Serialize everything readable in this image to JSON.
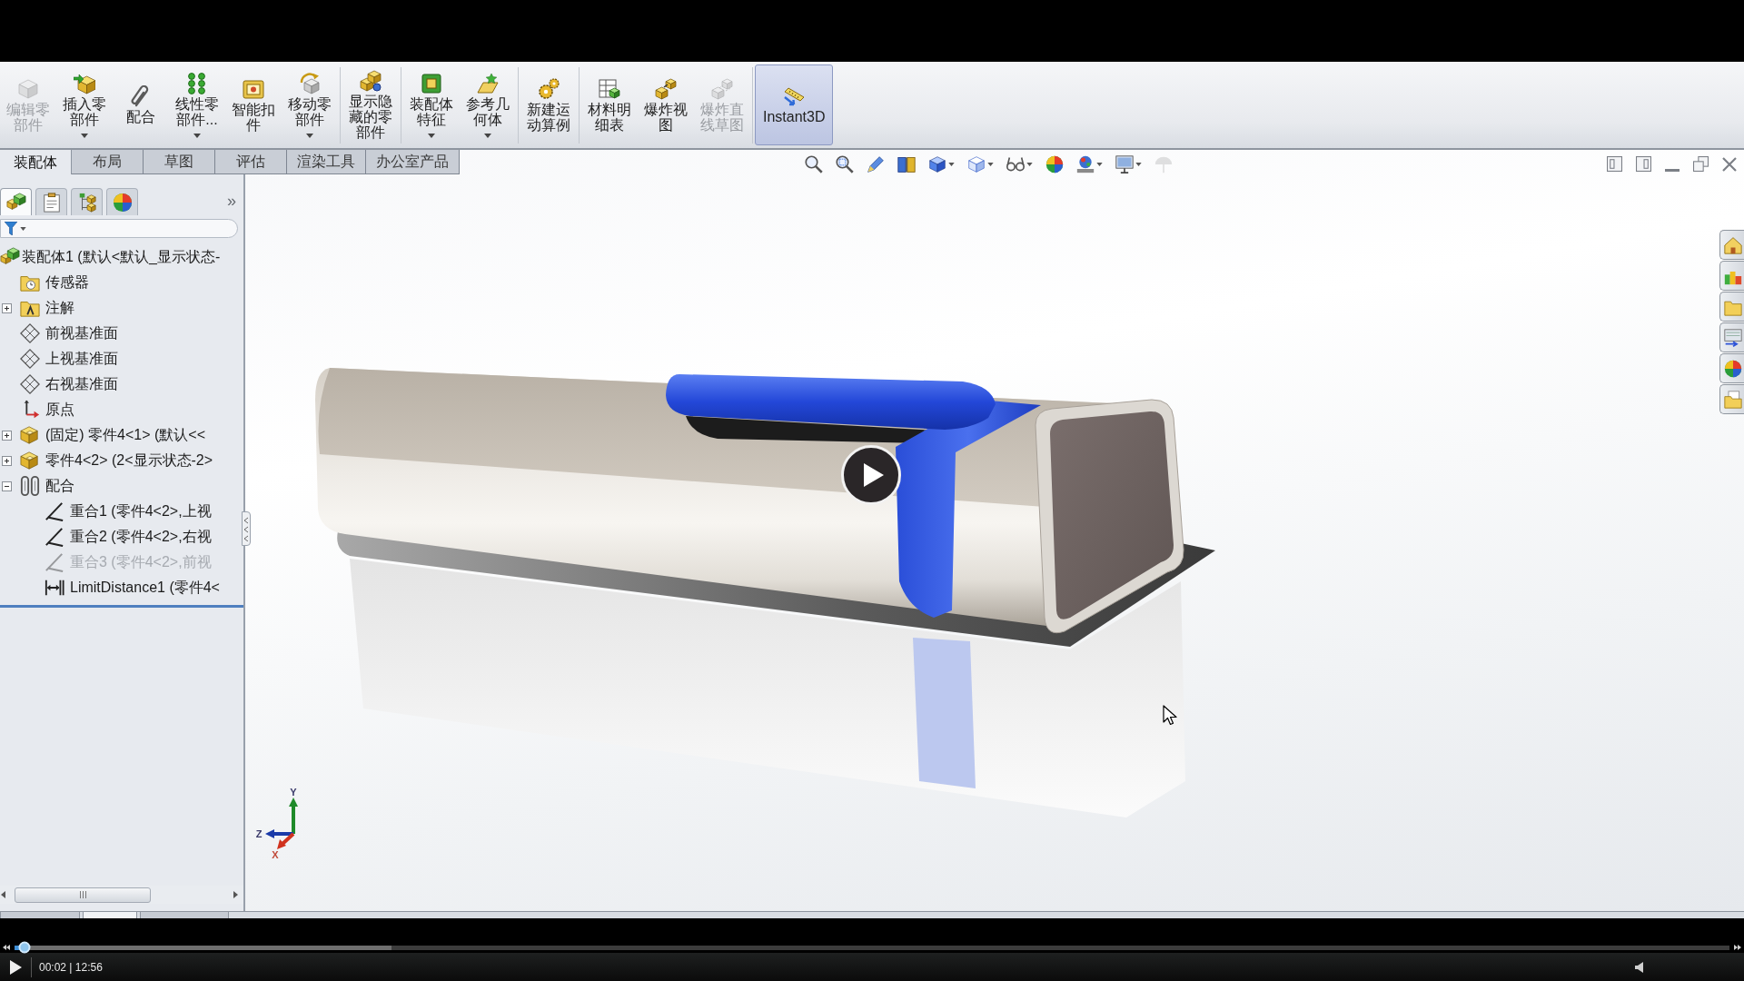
{
  "toolbar": {
    "groups": [
      [
        {
          "label": "编辑零部件",
          "dropdown": false,
          "disabled": true,
          "on": false
        },
        {
          "label": "插入零部件",
          "dropdown": true,
          "disabled": false,
          "on": false
        },
        {
          "label": "配合",
          "dropdown": false,
          "disabled": false,
          "on": false
        },
        {
          "label": "线性零部件...",
          "dropdown": true,
          "disabled": false,
          "on": false
        },
        {
          "label": "智能扣件",
          "dropdown": false,
          "disabled": false,
          "on": false
        },
        {
          "label": "移动零部件",
          "dropdown": true,
          "disabled": false,
          "on": false
        }
      ],
      [
        {
          "label": "显示隐藏的零部件",
          "dropdown": false,
          "disabled": false,
          "on": false
        }
      ],
      [
        {
          "label": "装配体特征",
          "dropdown": true,
          "disabled": false,
          "on": false
        },
        {
          "label": "参考几何体",
          "dropdown": true,
          "disabled": false,
          "on": false
        }
      ],
      [
        {
          "label": "新建运动算例",
          "dropdown": false,
          "disabled": false,
          "on": false
        }
      ],
      [
        {
          "label": "材料明细表",
          "dropdown": false,
          "disabled": false,
          "on": false
        },
        {
          "label": "爆炸视图",
          "dropdown": false,
          "disabled": false,
          "on": false
        },
        {
          "label": "爆炸直线草图",
          "dropdown": false,
          "disabled": true,
          "on": false
        }
      ],
      [
        {
          "label": "Instant3D",
          "dropdown": false,
          "disabled": false,
          "on": true
        }
      ]
    ]
  },
  "command_tabs": [
    {
      "label": "装配体",
      "selected": true
    },
    {
      "label": "布局",
      "selected": false
    },
    {
      "label": "草图",
      "selected": false
    },
    {
      "label": "评估",
      "selected": false
    },
    {
      "label": "渲染工具",
      "selected": false
    },
    {
      "label": "办公室产品",
      "selected": false
    }
  ],
  "view_toolbar": [
    {
      "dropdown": false,
      "disabled": false
    },
    {
      "dropdown": false,
      "disabled": false
    },
    {
      "dropdown": false,
      "disabled": false
    },
    {
      "dropdown": false,
      "disabled": false
    },
    {
      "dropdown": true,
      "disabled": false
    },
    {
      "dropdown": true,
      "disabled": false
    },
    {
      "dropdown": true,
      "disabled": false
    },
    {
      "dropdown": false,
      "disabled": false
    },
    {
      "dropdown": true,
      "disabled": false
    },
    {
      "dropdown": true,
      "disabled": false
    },
    {
      "dropdown": false,
      "disabled": true
    }
  ],
  "manager_tabs": [
    {
      "selected": true
    },
    {
      "selected": false
    },
    {
      "selected": false
    },
    {
      "selected": false
    }
  ],
  "manager_more": "»",
  "tree": [
    {
      "label": "装配体1 (默认<默认_显示状态-",
      "kind": "assembly",
      "suppressed": false,
      "children": [
        {
          "label": "传感器",
          "kind": "sensors",
          "suppressed": false
        },
        {
          "label": "注解",
          "kind": "annotations",
          "suppressed": false,
          "expanded": false
        },
        {
          "label": "前视基准面",
          "kind": "plane",
          "suppressed": false
        },
        {
          "label": "上视基准面",
          "kind": "plane",
          "suppressed": false
        },
        {
          "label": "右视基准面",
          "kind": "plane",
          "suppressed": false
        },
        {
          "label": "原点",
          "kind": "origin",
          "suppressed": false
        },
        {
          "label": "(固定) 零件4<1> (默认<<",
          "kind": "part",
          "suppressed": false,
          "expanded": false
        },
        {
          "label": "零件4<2> (2<显示状态-2>",
          "kind": "part",
          "suppressed": false,
          "expanded": false
        },
        {
          "label": "配合",
          "kind": "mates",
          "suppressed": false,
          "expanded": true,
          "children": [
            {
              "label": "重合1 (零件4<2>,上视",
              "kind": "coincident",
              "suppressed": false
            },
            {
              "label": "重合2 (零件4<2>,右视",
              "kind": "coincident",
              "suppressed": false
            },
            {
              "label": "重合3 (零件4<2>,前视",
              "kind": "coincident",
              "suppressed": true
            },
            {
              "label": "LimitDistance1 (零件4<",
              "kind": "distance",
              "suppressed": false
            }
          ]
        }
      ]
    }
  ],
  "triad": {
    "y": "Y",
    "z": "Z",
    "x": "X"
  },
  "sheet_tabs": [
    {
      "selected": false
    },
    {
      "selected": true
    },
    {
      "selected": false
    }
  ],
  "video_player": {
    "progress": {
      "level": 0.006
    },
    "buffer": {
      "level": 0.22
    },
    "time": "00:02 | 12:56"
  }
}
